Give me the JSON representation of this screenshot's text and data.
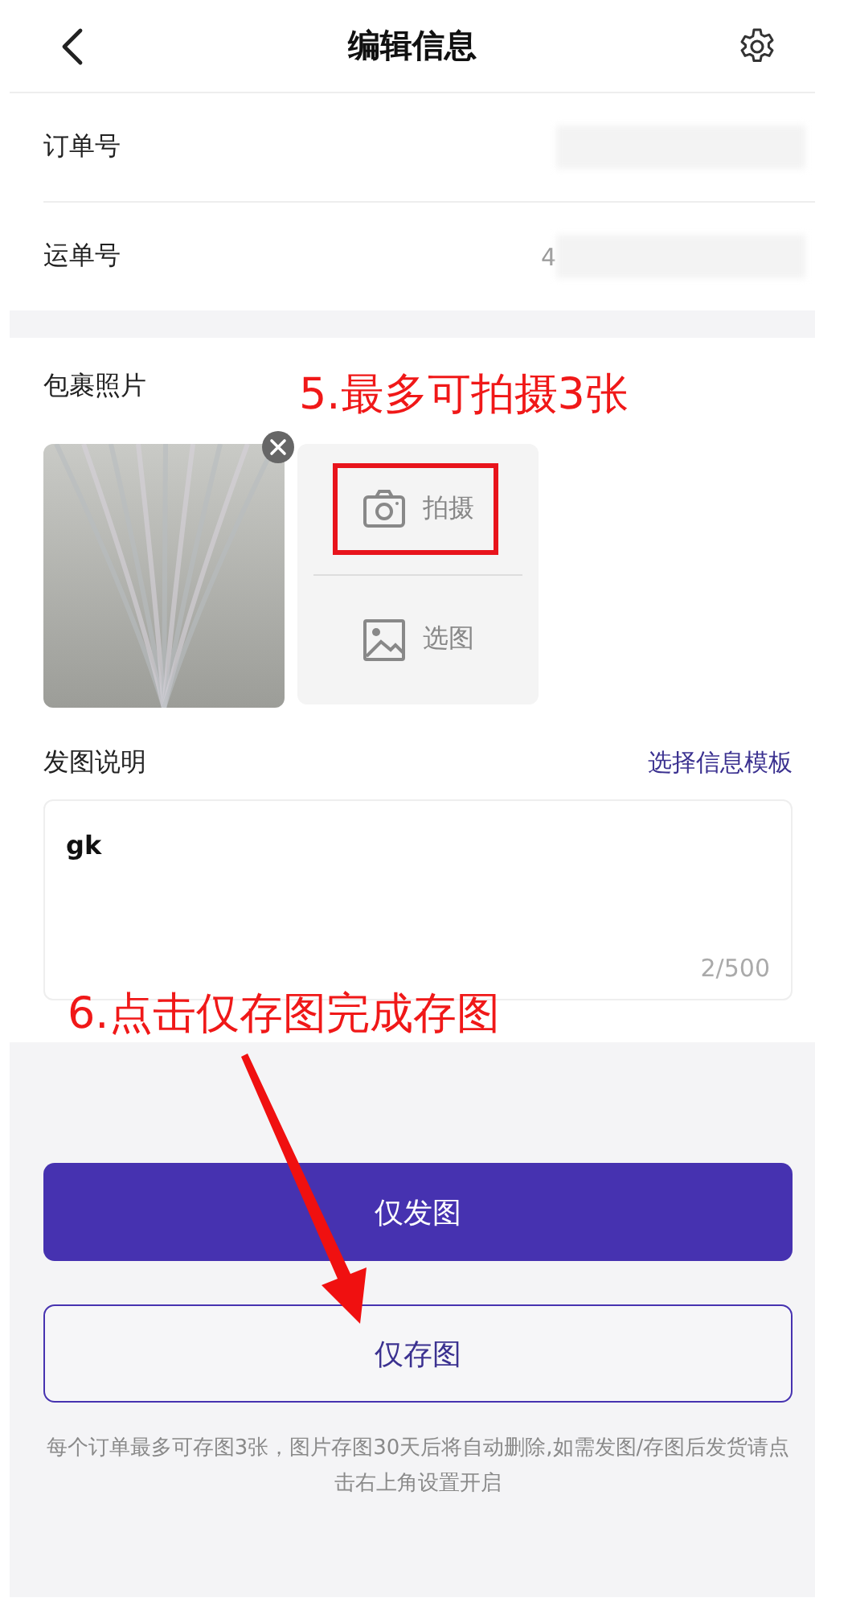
{
  "header": {
    "title": "编辑信息"
  },
  "fields": [
    {
      "label": "订单号"
    },
    {
      "label": "运单号",
      "value": "4"
    }
  ],
  "photos": {
    "label": "包裹照片",
    "actions": [
      {
        "kind": "camera",
        "label": "拍摄"
      },
      {
        "kind": "gallery",
        "label": "选图"
      }
    ]
  },
  "description": {
    "label": "发图说明",
    "template_link": "选择信息模板",
    "value": "gk",
    "counter": "2/500"
  },
  "buttons": [
    {
      "kind": "primary",
      "label": "仅发图"
    },
    {
      "kind": "outline",
      "label": "仅存图"
    }
  ],
  "note": "每个订单最多可存图3张，图片存图30天后将自动删除,如需发图/存图后发货请点击右上角设置开启",
  "annotations": [
    {
      "text": "5.最多可拍摄3张"
    },
    {
      "text": "6.点击仅存图完成存图"
    }
  ]
}
